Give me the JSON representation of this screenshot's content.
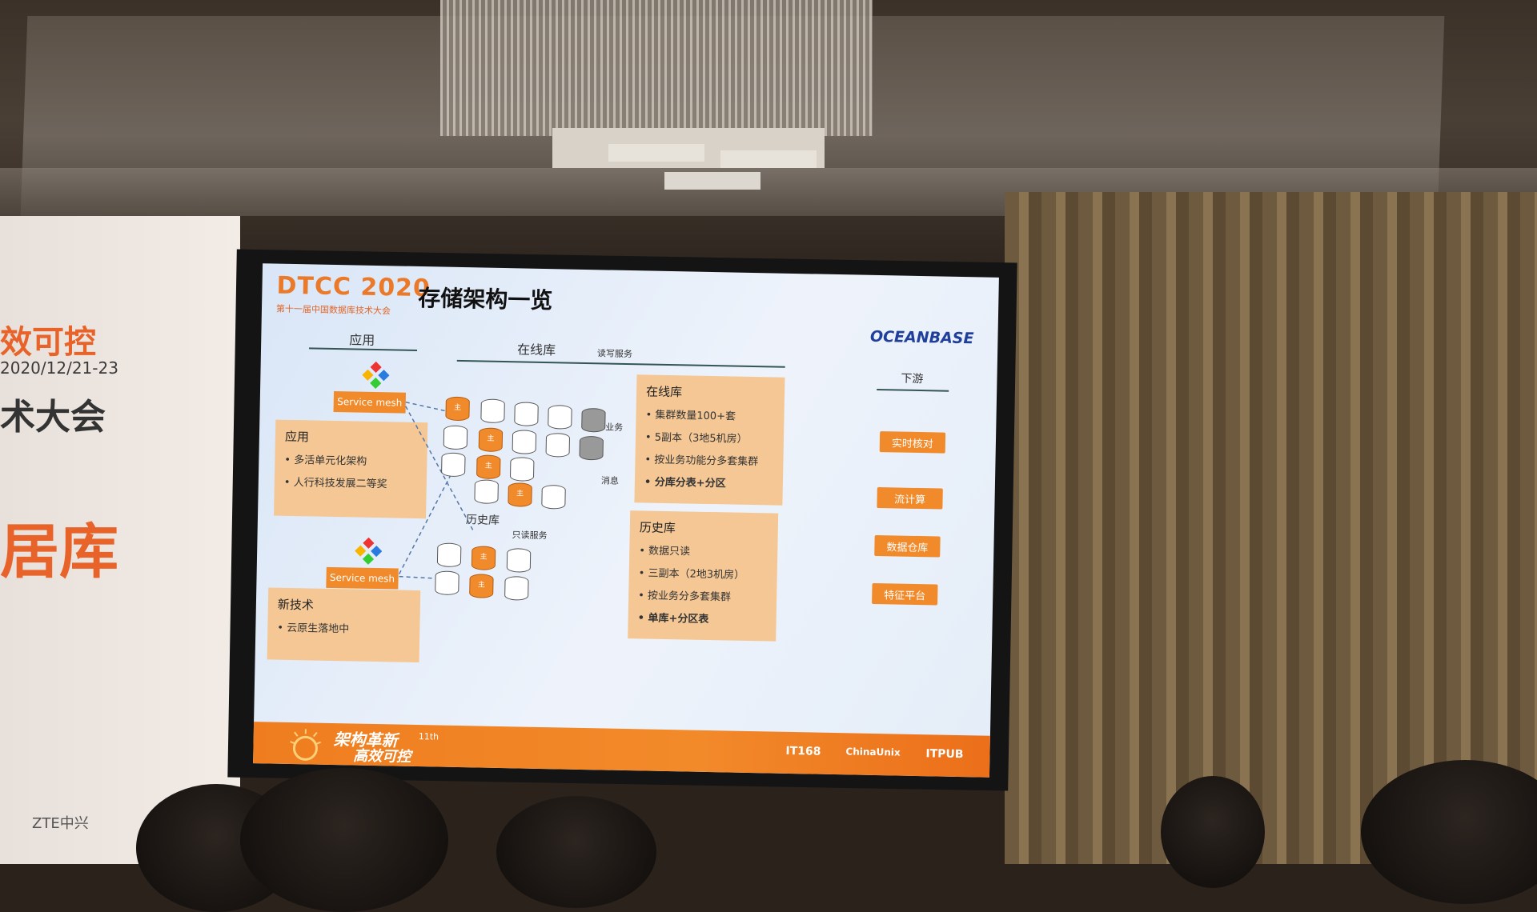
{
  "banner": {
    "line1": "效可控",
    "line2": "2020/12/21-23",
    "line3": "术大会",
    "line4": "居库",
    "sponsor": "ZTE中兴"
  },
  "slide": {
    "logo": "DTCC 2020",
    "logo_sub": "第十一届中国数据库技术大会",
    "title": "存储架构一览",
    "brand": "OCEANBASE",
    "col_app": "应用",
    "col_online": "在线库",
    "col_online_sub": "读写服务",
    "col_downstream": "下游",
    "service_mesh": "Service mesh",
    "app_panel": {
      "title": "应用",
      "items": [
        "多活单元化架构",
        "人行科技发展二等奖"
      ]
    },
    "newtech_panel": {
      "title": "新技术",
      "items": [
        "云原生落地中"
      ]
    },
    "history_label": "历史库",
    "history_sub": "只读服务",
    "biz_label": "业务",
    "msg_label": "消息",
    "online_panel": {
      "title": "在线库",
      "items": [
        "集群数量100+套",
        "5副本（3地5机房）",
        "按业务功能分多套集群",
        "分库分表+分区"
      ]
    },
    "history_panel": {
      "title": "历史库",
      "items": [
        "数据只读",
        "三副本（2地3机房）",
        "按业务分多套集群",
        "单库+分区表"
      ]
    },
    "downstream": [
      "实时核对",
      "流计算",
      "数据仓库",
      "特征平台"
    ],
    "footer": {
      "slogan1": "架构革新",
      "slogan2": "高效可控",
      "edition": "11th",
      "logos": [
        "IT168",
        "ChinaUnix",
        "ITPUB"
      ]
    }
  },
  "colors": {
    "accent": "#f08a2a",
    "panel": "#f4c795",
    "brand_blue": "#1f3f9a"
  }
}
